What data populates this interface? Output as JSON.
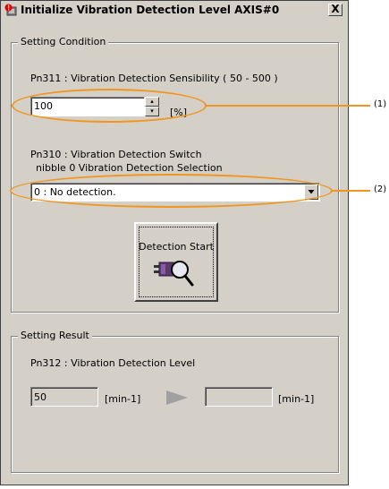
{
  "window": {
    "title": "Initialize Vibration Detection Level AXIS#0",
    "close_symbol": "X"
  },
  "setting_condition": {
    "group_label": "Setting Condition",
    "pn311_label": "Pn311 : Vibration Detection Sensibility  ( 50 - 500 )",
    "pn311_value": "100",
    "pn311_unit": "[%]",
    "spin_up": "▴",
    "spin_down": "▾",
    "pn310_label": "Pn310 : Vibration Detection Switch",
    "pn310_sublabel": "nibble 0 Vibration Detection Selection",
    "pn310_selected": "0 : No detection.",
    "start_button_label": "Detection Start"
  },
  "setting_result": {
    "group_label": "Setting Result",
    "pn312_label": "Pn312 : Vibration Detection Level",
    "current_value": "50",
    "current_unit": "[min-1]",
    "new_value": "",
    "new_unit": "[min-1]"
  },
  "annotations": {
    "callout_1": "(1)",
    "callout_2": "(2)",
    "color": "#f0961e"
  },
  "icons": {
    "window": "app-alert-icon",
    "start_button": "detection-magnifier-icon",
    "arrow": "right-arrow-icon"
  }
}
